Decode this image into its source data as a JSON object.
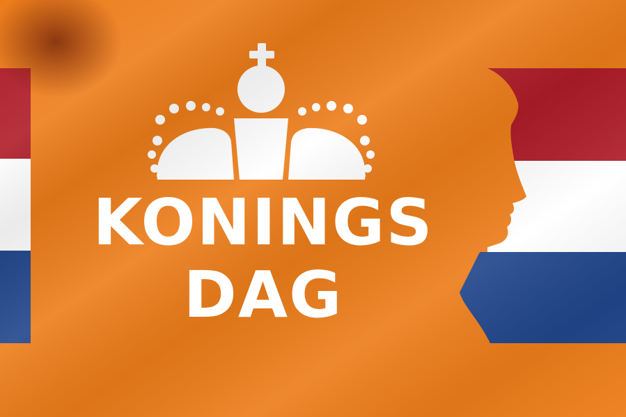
{
  "banner": {
    "title_line1": "KONINGS",
    "title_line2": "DAG"
  },
  "colors": {
    "orange": "#ed7d1a",
    "red": "#ae1c28",
    "white": "#ffffff",
    "blue": "#21468b"
  },
  "icons": [
    "crown-icon",
    "king-silhouette-icon"
  ]
}
